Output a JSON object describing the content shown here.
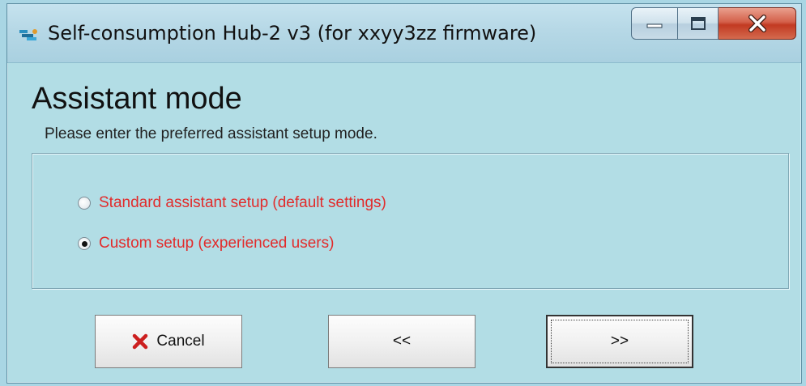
{
  "window": {
    "title": "Self-consumption Hub-2 v3 (for xxyy3zz firmware)"
  },
  "page": {
    "heading": "Assistant mode",
    "subtitle": "Please enter the preferred assistant setup mode."
  },
  "options": [
    {
      "label": "Standard assistant setup (default settings)",
      "selected": false
    },
    {
      "label": "Custom setup (experienced users)",
      "selected": true
    }
  ],
  "buttons": {
    "cancel": "Cancel",
    "back": "<<",
    "next": ">>"
  },
  "colors": {
    "option_text": "#e22b2b",
    "cancel_icon": "#cc1f1f",
    "background": "#b2dde5"
  }
}
